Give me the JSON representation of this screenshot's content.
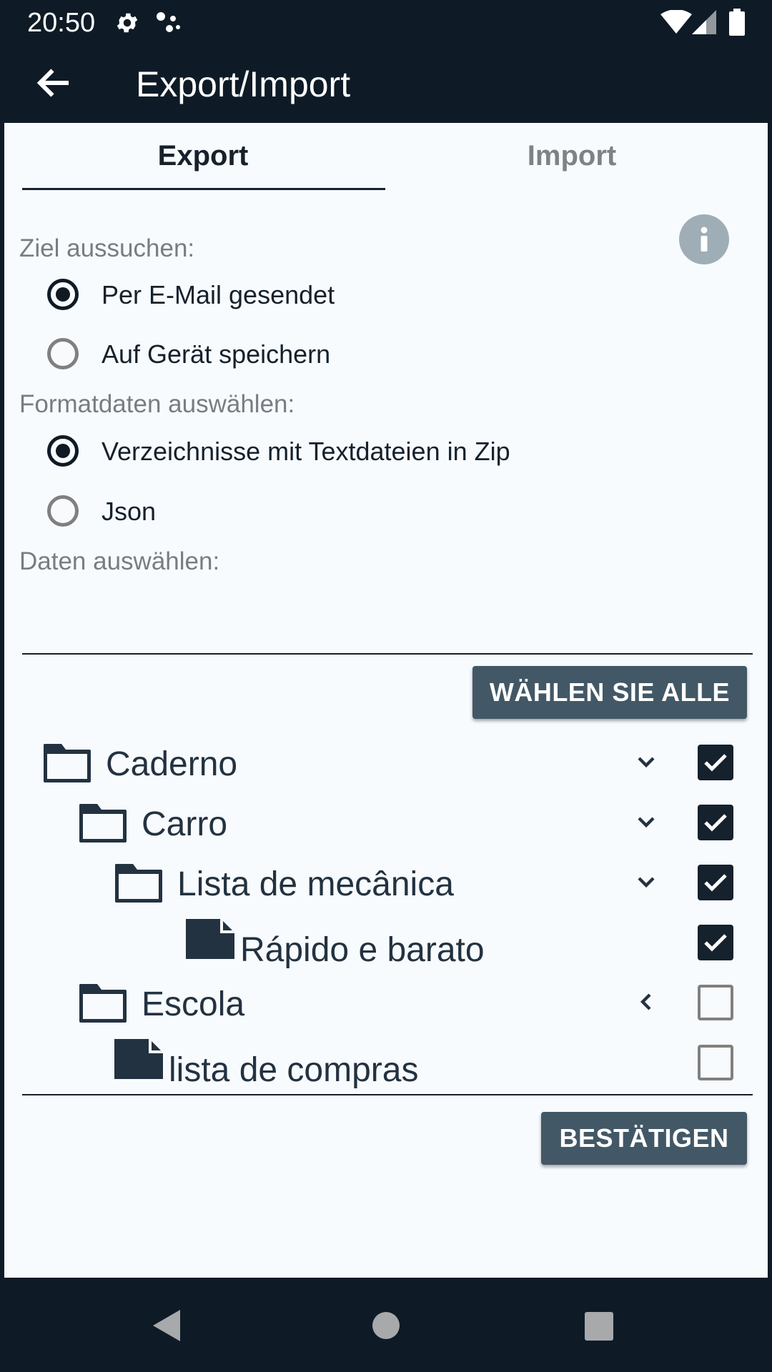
{
  "status_bar": {
    "time": "20:50",
    "icons": [
      "gear-icon",
      "assistant-dots-icon",
      "wifi-icon",
      "signal-icon",
      "battery-icon"
    ]
  },
  "app_bar": {
    "title": "Export/Import",
    "back_icon": "arrow-left-icon"
  },
  "tabs": [
    {
      "label": "Export",
      "selected": true
    },
    {
      "label": "Import",
      "selected": false
    }
  ],
  "target": {
    "label": "Ziel aussuchen:",
    "options": [
      {
        "label": "Per E-Mail gesendet",
        "checked": true
      },
      {
        "label": "Auf Gerät speichern",
        "checked": false
      }
    ]
  },
  "format": {
    "label": "Formatdaten auswählen:",
    "options": [
      {
        "label": "Verzeichnisse mit Textdateien in Zip",
        "checked": true
      },
      {
        "label": "Json",
        "checked": false
      }
    ]
  },
  "data_select": {
    "label": "Daten auswählen:",
    "select_all_button": "WÄHLEN SIE ALLE"
  },
  "tree": [
    {
      "type": "folder",
      "label": "Caderno",
      "checked": true,
      "expanded": true,
      "level": 0
    },
    {
      "type": "folder",
      "label": "Carro",
      "checked": true,
      "expanded": true,
      "level": 1
    },
    {
      "type": "folder",
      "label": "Lista de mecânica",
      "checked": true,
      "expanded": true,
      "level": 2
    },
    {
      "type": "file",
      "label": "Rápido e barato",
      "checked": true,
      "level": 3
    },
    {
      "type": "folder",
      "label": "Escola",
      "checked": false,
      "expanded": false,
      "level": 1
    },
    {
      "type": "file",
      "label": "lista de compras",
      "checked": false,
      "level": 2
    }
  ],
  "confirm_button": "BESTÄTIGEN",
  "colors": {
    "bar": "#0e1b27",
    "content_bg": "#f8fbfe",
    "button": "#435866",
    "text": "#15212c",
    "muted": "#787d82"
  }
}
